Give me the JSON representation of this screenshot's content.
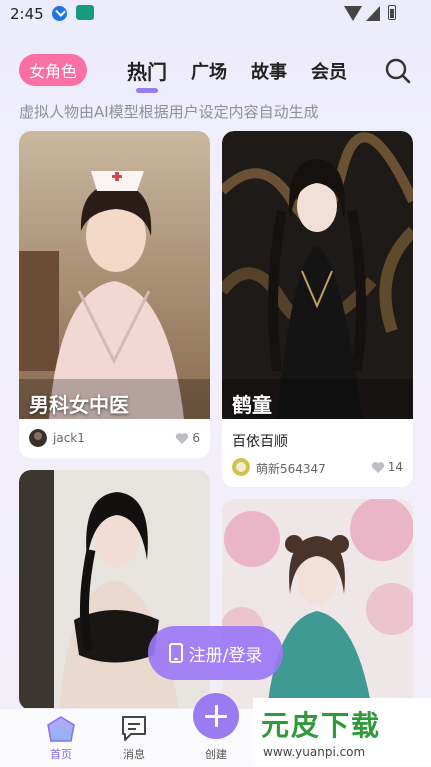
{
  "status_bar": {
    "time": "2:45"
  },
  "header": {
    "category_pill": "女角色",
    "tabs": [
      {
        "label": "热门",
        "active": true
      },
      {
        "label": "广场",
        "active": false
      },
      {
        "label": "故事",
        "active": false
      },
      {
        "label": "会员",
        "active": false
      }
    ],
    "subtitle": "虚拟人物由AI模型根据用户设定内容自动生成"
  },
  "cards": [
    {
      "title": "男科女中医",
      "description": "",
      "author": "jack1",
      "likes": "6"
    },
    {
      "title": "鹤童",
      "description": "百依百顺",
      "author": "萌新564347",
      "likes": "14"
    },
    {
      "title": "",
      "description": "",
      "author": "",
      "likes": ""
    },
    {
      "title": "",
      "description": "",
      "author": "",
      "likes": ""
    }
  ],
  "register_button": "注册/登录",
  "bottom_nav": [
    {
      "label": "首页",
      "icon": "home-icon",
      "active": true
    },
    {
      "label": "消息",
      "icon": "message-icon",
      "active": false
    },
    {
      "label": "创建",
      "icon": "plus-icon",
      "active": false
    }
  ],
  "watermark": {
    "main": "元皮下载",
    "url": "www.yuanpi.com"
  },
  "colors": {
    "accent": "#9b7bf0",
    "pill": "#fb6fa3",
    "watermark": "#2e9a3c"
  }
}
